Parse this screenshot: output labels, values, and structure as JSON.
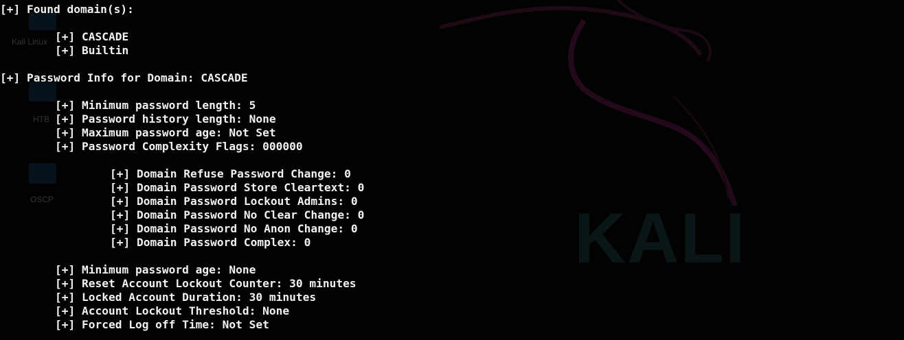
{
  "desktop": {
    "icons": [
      {
        "name": "kali-linux",
        "label": "Kali Linux"
      },
      {
        "name": "htb",
        "label": "HTB"
      },
      {
        "name": "oscp",
        "label": "OSCP"
      }
    ],
    "wallpaper_text": "KALI",
    "colors": {
      "background": "#020203",
      "text": "#f2f2f2",
      "dragon": "#2a0a1c"
    }
  },
  "terminal": {
    "found_domains_header": "[+] Found domain(s):",
    "domains": [
      "[+] CASCADE",
      "[+] Builtin"
    ],
    "password_info_header": "[+] Password Info for Domain: CASCADE",
    "policy_lines": [
      "[+] Minimum password length: 5",
      "[+] Password history length: None",
      "[+] Maximum password age: Not Set",
      "[+] Password Complexity Flags: 000000"
    ],
    "complexity_flags": [
      "[+] Domain Refuse Password Change: 0",
      "[+] Domain Password Store Cleartext: 0",
      "[+] Domain Password Lockout Admins: 0",
      "[+] Domain Password No Clear Change: 0",
      "[+] Domain Password No Anon Change: 0",
      "[+] Domain Password Complex: 0"
    ],
    "lockout_lines": [
      "[+] Minimum password age: None",
      "[+] Reset Account Lockout Counter: 30 minutes",
      "[+] Locked Account Duration: 30 minutes",
      "[+] Account Lockout Threshold: None",
      "[+] Forced Log off Time: Not Set"
    ]
  }
}
